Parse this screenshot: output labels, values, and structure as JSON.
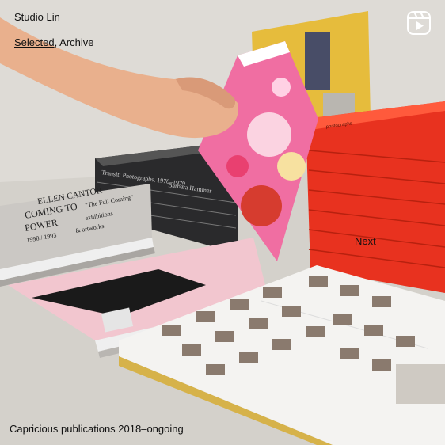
{
  "header": {
    "brand": "Studio Lin",
    "nav": {
      "selected": "Selected",
      "separator": ",",
      "archive": "Archive"
    }
  },
  "carousel": {
    "next_label": "Next"
  },
  "footer": {
    "caption": "Capricious publications 2018–ongoing"
  },
  "photo": {
    "book_text": {
      "gray_title": "ELLEN CANTOR",
      "gray_sub1": "COMING TO",
      "gray_sub2": "\"The Full Coming\"",
      "gray_sub3": "POWER",
      "gray_sub4": "exhibitions",
      "gray_sub5": "1998 / 1993",
      "gray_sub6": "& artworks",
      "black_spine_title": "Transit: Photographs, 1970–1979",
      "black_spine_author": "Barbara Hammer",
      "red_spine_text": "photographs"
    }
  },
  "icons": {
    "reel": "reel-icon"
  },
  "colors": {
    "text": "#111111",
    "background": "#d9d6d1"
  }
}
